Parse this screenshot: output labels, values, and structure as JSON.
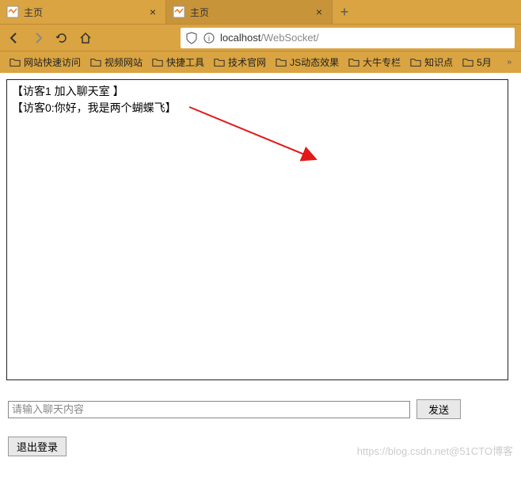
{
  "tabs": [
    {
      "title": "主页",
      "active": false
    },
    {
      "title": "主页",
      "active": true
    }
  ],
  "url": {
    "host": "localhost",
    "path": "/WebSocket/"
  },
  "bookmarks": [
    "网站快速访问",
    "视频网站",
    "快捷工具",
    "技术官网",
    "JS动态效果",
    "大牛专栏",
    "知识点",
    "5月"
  ],
  "chat": {
    "messages": [
      "【访客1 加入聊天室 】",
      "【访客0:你好，我是两个蝴蝶飞】"
    ],
    "placeholder": "请输入聊天内容",
    "send_label": "发送",
    "logout_label": "退出登录"
  },
  "watermark": "https://blog.csdn.net@51CTO博客"
}
